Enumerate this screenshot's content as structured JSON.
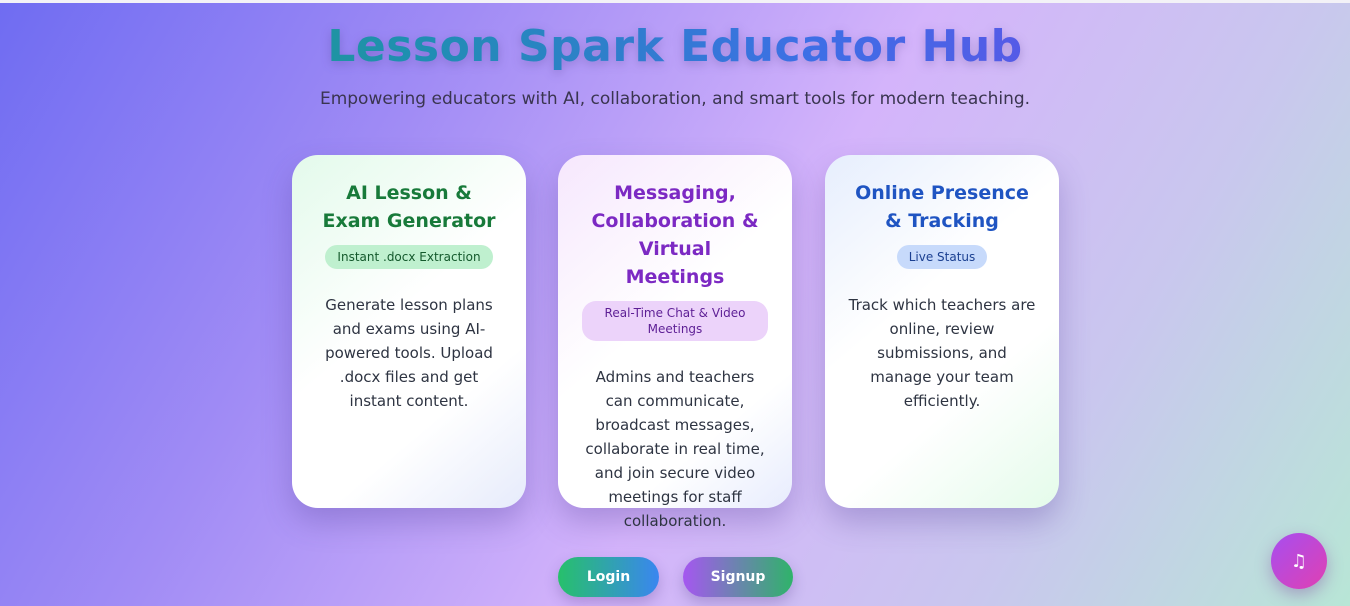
{
  "hero": {
    "title": "Lesson Spark Educator Hub",
    "subtitle": "Empowering educators with AI, collaboration, and smart tools for modern teaching."
  },
  "cards": [
    {
      "title": "AI Lesson & Exam Generator",
      "badge": "Instant .docx Extraction",
      "text": "Generate lesson plans and exams using AI-powered tools. Upload .docx files and get instant content."
    },
    {
      "title": "Messaging, Collaboration & Virtual Meetings",
      "badge": "Real-Time Chat & Video Meetings",
      "text": "Admins and teachers can communicate, broadcast messages, collaborate in real time, and join secure video meetings for staff collaboration."
    },
    {
      "title": "Online Presence & Tracking",
      "badge": "Live Status",
      "text": "Track which teachers are online, review submissions, and manage your team efficiently."
    }
  ],
  "actions": {
    "login_label": "Login",
    "signup_label": "Signup"
  },
  "music_button": {
    "icon": "music-note-icon",
    "glyph": "♫"
  },
  "colors": {
    "card1_title": "#187a3a",
    "card2_title": "#7c29c3",
    "card3_title": "#1f54c2"
  }
}
